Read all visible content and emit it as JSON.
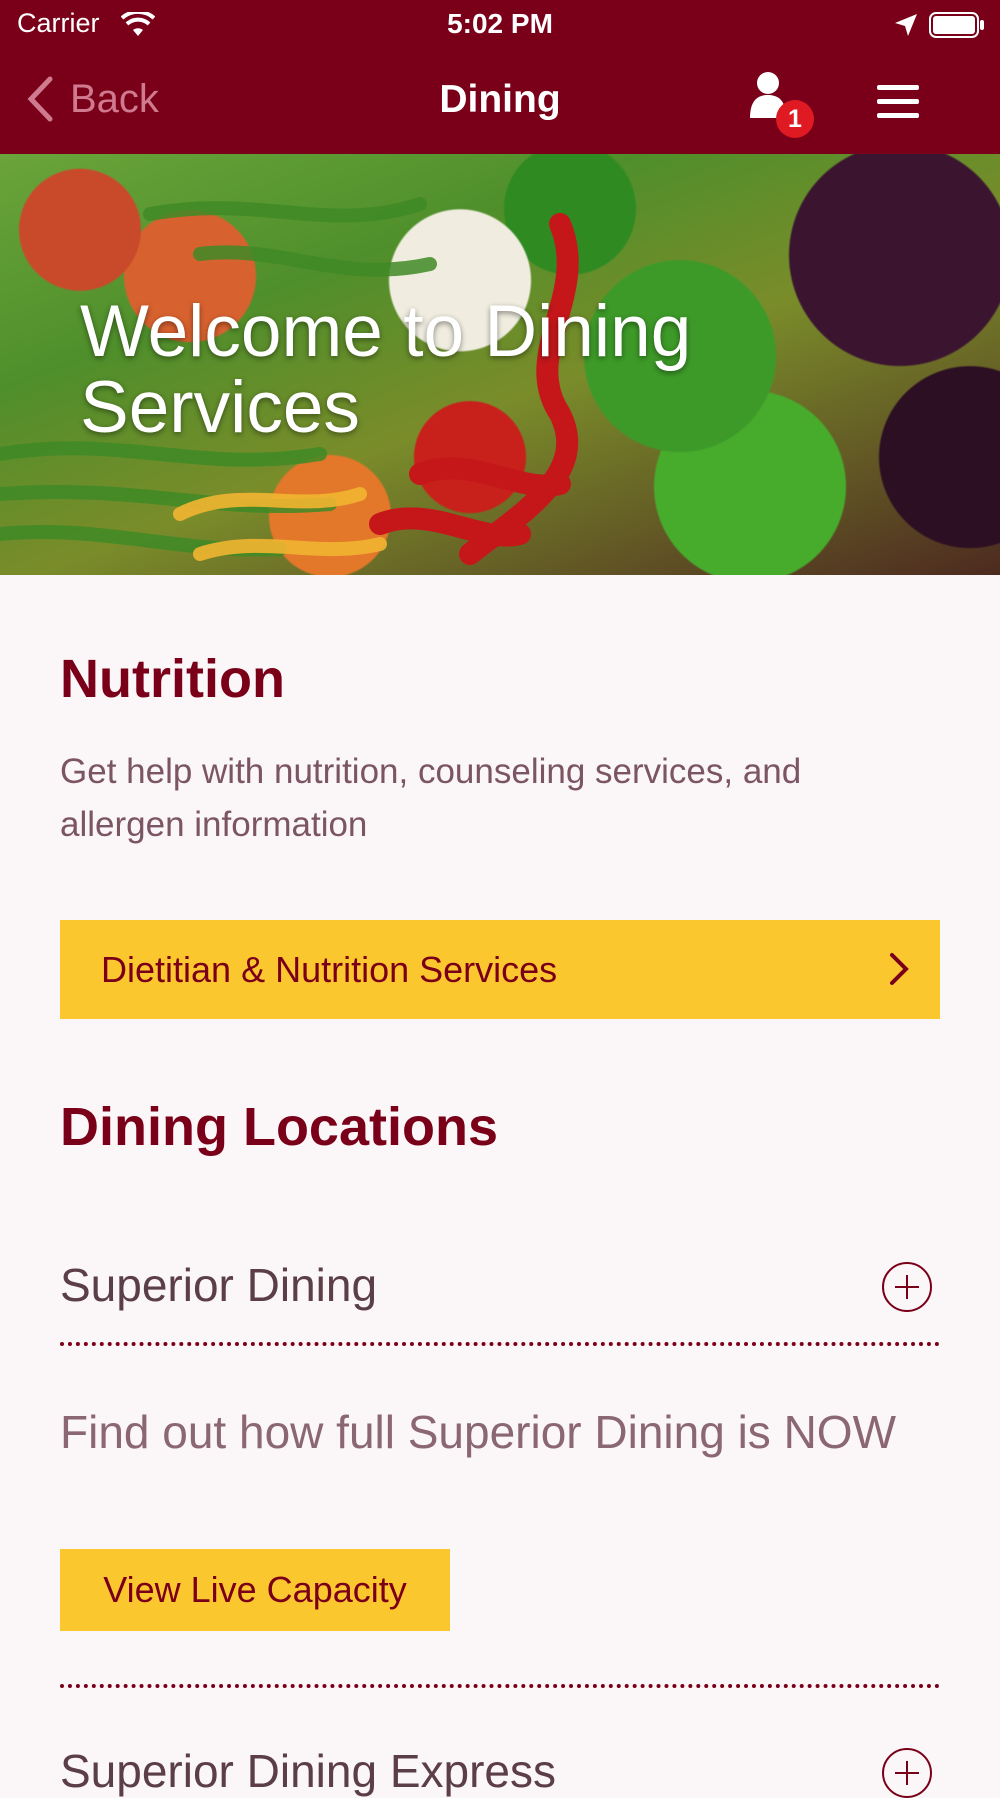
{
  "status_bar": {
    "carrier": "Carrier",
    "time": "5:02 PM"
  },
  "nav": {
    "back_label": "Back",
    "title": "Dining",
    "notification_count": "1"
  },
  "hero": {
    "title": "Welcome to Dining Services"
  },
  "nutrition": {
    "heading": "Nutrition",
    "description": "Get help with nutrition, counseling services, and allergen information",
    "button_label": "Dietitian & Nutrition Services"
  },
  "dining_locations": {
    "heading": "Dining Locations",
    "items": [
      {
        "name": "Superior Dining"
      },
      {
        "name": "Superior Dining Express"
      }
    ],
    "capacity_text": "Find out how full Superior Dining is NOW",
    "capacity_button": "View Live Capacity"
  },
  "colors": {
    "brand": "#7a0019",
    "accent": "#fbc72e",
    "background": "#fbf6f8"
  },
  "icons": [
    "wifi-icon",
    "location-arrow-icon",
    "battery-icon",
    "back-chevron-icon",
    "profile-icon",
    "hamburger-menu-icon",
    "chevron-right-icon",
    "plus-circle-icon"
  ]
}
